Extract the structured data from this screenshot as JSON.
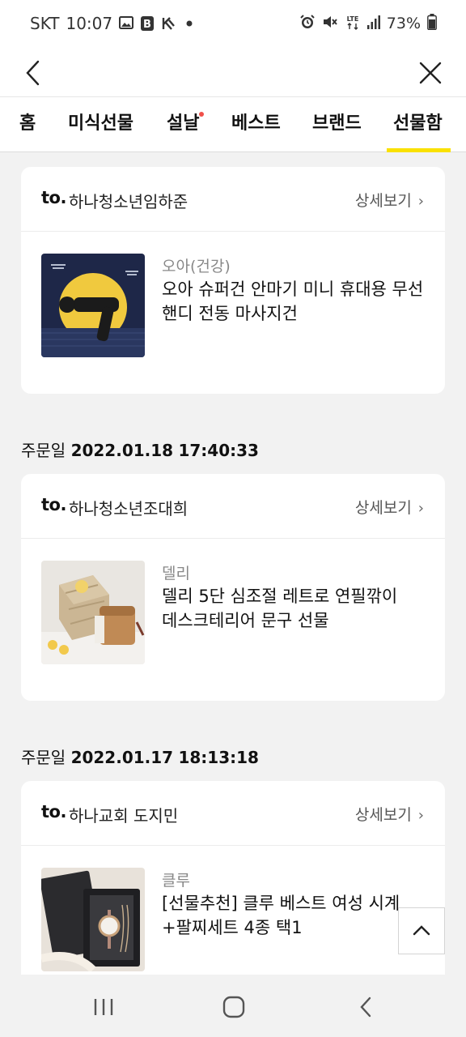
{
  "status_bar": {
    "carrier": "SKT",
    "time": "10:07",
    "battery": "73%",
    "network": "LTE",
    "left_icons": [
      "gallery-icon",
      "b-app-icon",
      "k-app-icon",
      "dot-icon"
    ],
    "right_icons": [
      "alarm-icon",
      "mute-icon",
      "lte-icon",
      "signal-icon",
      "battery-icon"
    ]
  },
  "nav": {
    "back_icon": "chevron-left-icon",
    "close_icon": "close-icon"
  },
  "tabs": [
    {
      "label": "홈"
    },
    {
      "label": "미식선물"
    },
    {
      "label": "설날",
      "badge": "new-dot"
    },
    {
      "label": "베스트"
    },
    {
      "label": "브랜드"
    },
    {
      "label": "선물함",
      "active": true
    }
  ],
  "gifts": [
    {
      "to_prefix": "to.",
      "recipient": "하나청소년임하준",
      "detail_label": "상세보기",
      "brand": "오아(건강)",
      "product_name": "오아 슈퍼건 안마기 미니 휴대용 무선 핸디 전동 마사지건"
    },
    {
      "order_label": "주문일",
      "order_date": "2022.01.18",
      "order_time": "17:40:33",
      "to_prefix": "to.",
      "recipient": "하나청소년조대희",
      "detail_label": "상세보기",
      "brand": "델리",
      "product_name": "델리 5단 심조절 레트로 연필깎이 데스크테리어 문구 선물"
    },
    {
      "order_label": "주문일",
      "order_date": "2022.01.17",
      "order_time": "18:13:18",
      "to_prefix": "to.",
      "recipient": "하나교회 도지민",
      "detail_label": "상세보기",
      "brand": "클루",
      "product_name": "[선물추천] 클루 베스트 여성 시계+팔찌세트 4종 택1"
    }
  ],
  "colors": {
    "accent": "#fae100",
    "badge": "#f0504a",
    "background": "#f2f2f2"
  },
  "system_nav": {
    "recents_icon": "recents-icon",
    "home_icon": "home-icon",
    "back_icon": "back-icon"
  }
}
